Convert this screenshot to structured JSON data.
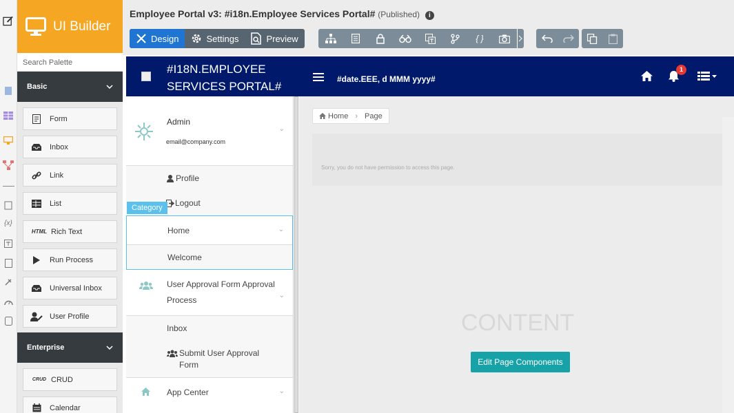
{
  "app": {
    "brand": "UI Builder",
    "search_placeholder": "Search Palette",
    "page_title": "Employee Portal v3: #i18n.Employee Services Portal#",
    "status": "(Published)"
  },
  "modes": [
    {
      "label": "Design"
    },
    {
      "label": "Settings"
    },
    {
      "label": "Preview"
    }
  ],
  "palette": {
    "basic_label": "Basic",
    "basic_items": [
      {
        "label": "Form"
      },
      {
        "label": "Inbox"
      },
      {
        "label": "Link"
      },
      {
        "label": "List"
      },
      {
        "label": "Rich Text",
        "icon_text": "HTML"
      },
      {
        "label": "Run Process"
      },
      {
        "label": "Universal Inbox"
      },
      {
        "label": "User Profile"
      }
    ],
    "enterprise_label": "Enterprise",
    "enterprise_items": [
      {
        "label": "CRUD",
        "icon_text": "CRUD"
      },
      {
        "label": "Calendar"
      }
    ]
  },
  "portal": {
    "title": "#I18N.EMPLOYEE SERVICES PORTAL#",
    "date": "#date.EEE, d MMM yyyy#",
    "notification_count": "1",
    "user_name": "Admin",
    "user_email": "email@company.com",
    "profile": "Profile",
    "logout": "Logout",
    "category_label": "Category",
    "menu": {
      "home": "Home",
      "welcome": "Welcome",
      "approval": "User Approval Form Approval Process",
      "inbox": "Inbox",
      "submit": "Submit User Approval Form",
      "app_center": "App Center"
    },
    "breadcrumb": {
      "home": "Home",
      "page": "Page"
    },
    "permission_msg": "Sorry, you do not have permission to access this page.",
    "content_placeholder": "CONTENT",
    "edit_button": "Edit Page Components"
  },
  "colors": {
    "brand": "#f5a623",
    "navbar": "#00196b",
    "active_mode": "#1f75d1",
    "edit_button": "#17a2a8",
    "category_highlight": "#5bc0eb"
  }
}
